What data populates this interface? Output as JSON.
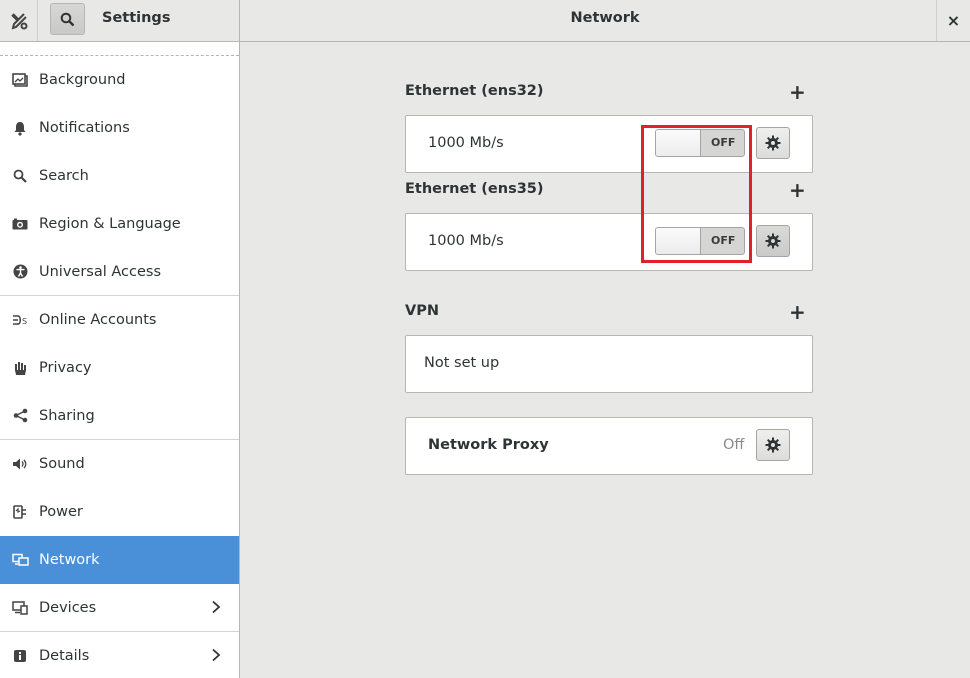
{
  "header": {
    "app_title": "Settings",
    "page_title": "Network",
    "close_label": "×"
  },
  "sidebar": {
    "items": [
      {
        "label": "Background",
        "icon": "background-icon"
      },
      {
        "label": "Notifications",
        "icon": "bell-icon"
      },
      {
        "label": "Search",
        "icon": "search-icon"
      },
      {
        "label": "Region & Language",
        "icon": "camera-icon"
      },
      {
        "label": "Universal Access",
        "icon": "accessibility-icon"
      },
      {
        "label": "Online Accounts",
        "icon": "online-accounts-icon"
      },
      {
        "label": "Privacy",
        "icon": "hand-icon"
      },
      {
        "label": "Sharing",
        "icon": "share-icon"
      },
      {
        "label": "Sound",
        "icon": "speaker-icon"
      },
      {
        "label": "Power",
        "icon": "power-plug-icon"
      },
      {
        "label": "Network",
        "icon": "network-icon",
        "active": true
      },
      {
        "label": "Devices",
        "icon": "devices-icon"
      },
      {
        "label": "Details",
        "icon": "info-icon"
      }
    ]
  },
  "main": {
    "ethernet1": {
      "title": "Ethernet (ens32)",
      "speed": "1000 Mb/s",
      "toggle": "OFF"
    },
    "ethernet2": {
      "title": "Ethernet (ens35)",
      "speed": "1000 Mb/s",
      "toggle": "OFF"
    },
    "vpn": {
      "title": "VPN",
      "status": "Not set up"
    },
    "proxy": {
      "title": "Network Proxy",
      "status": "Off"
    }
  },
  "colors": {
    "accent": "#4a90d9",
    "highlight": "#e0202a",
    "background": "#e8e8e7"
  }
}
